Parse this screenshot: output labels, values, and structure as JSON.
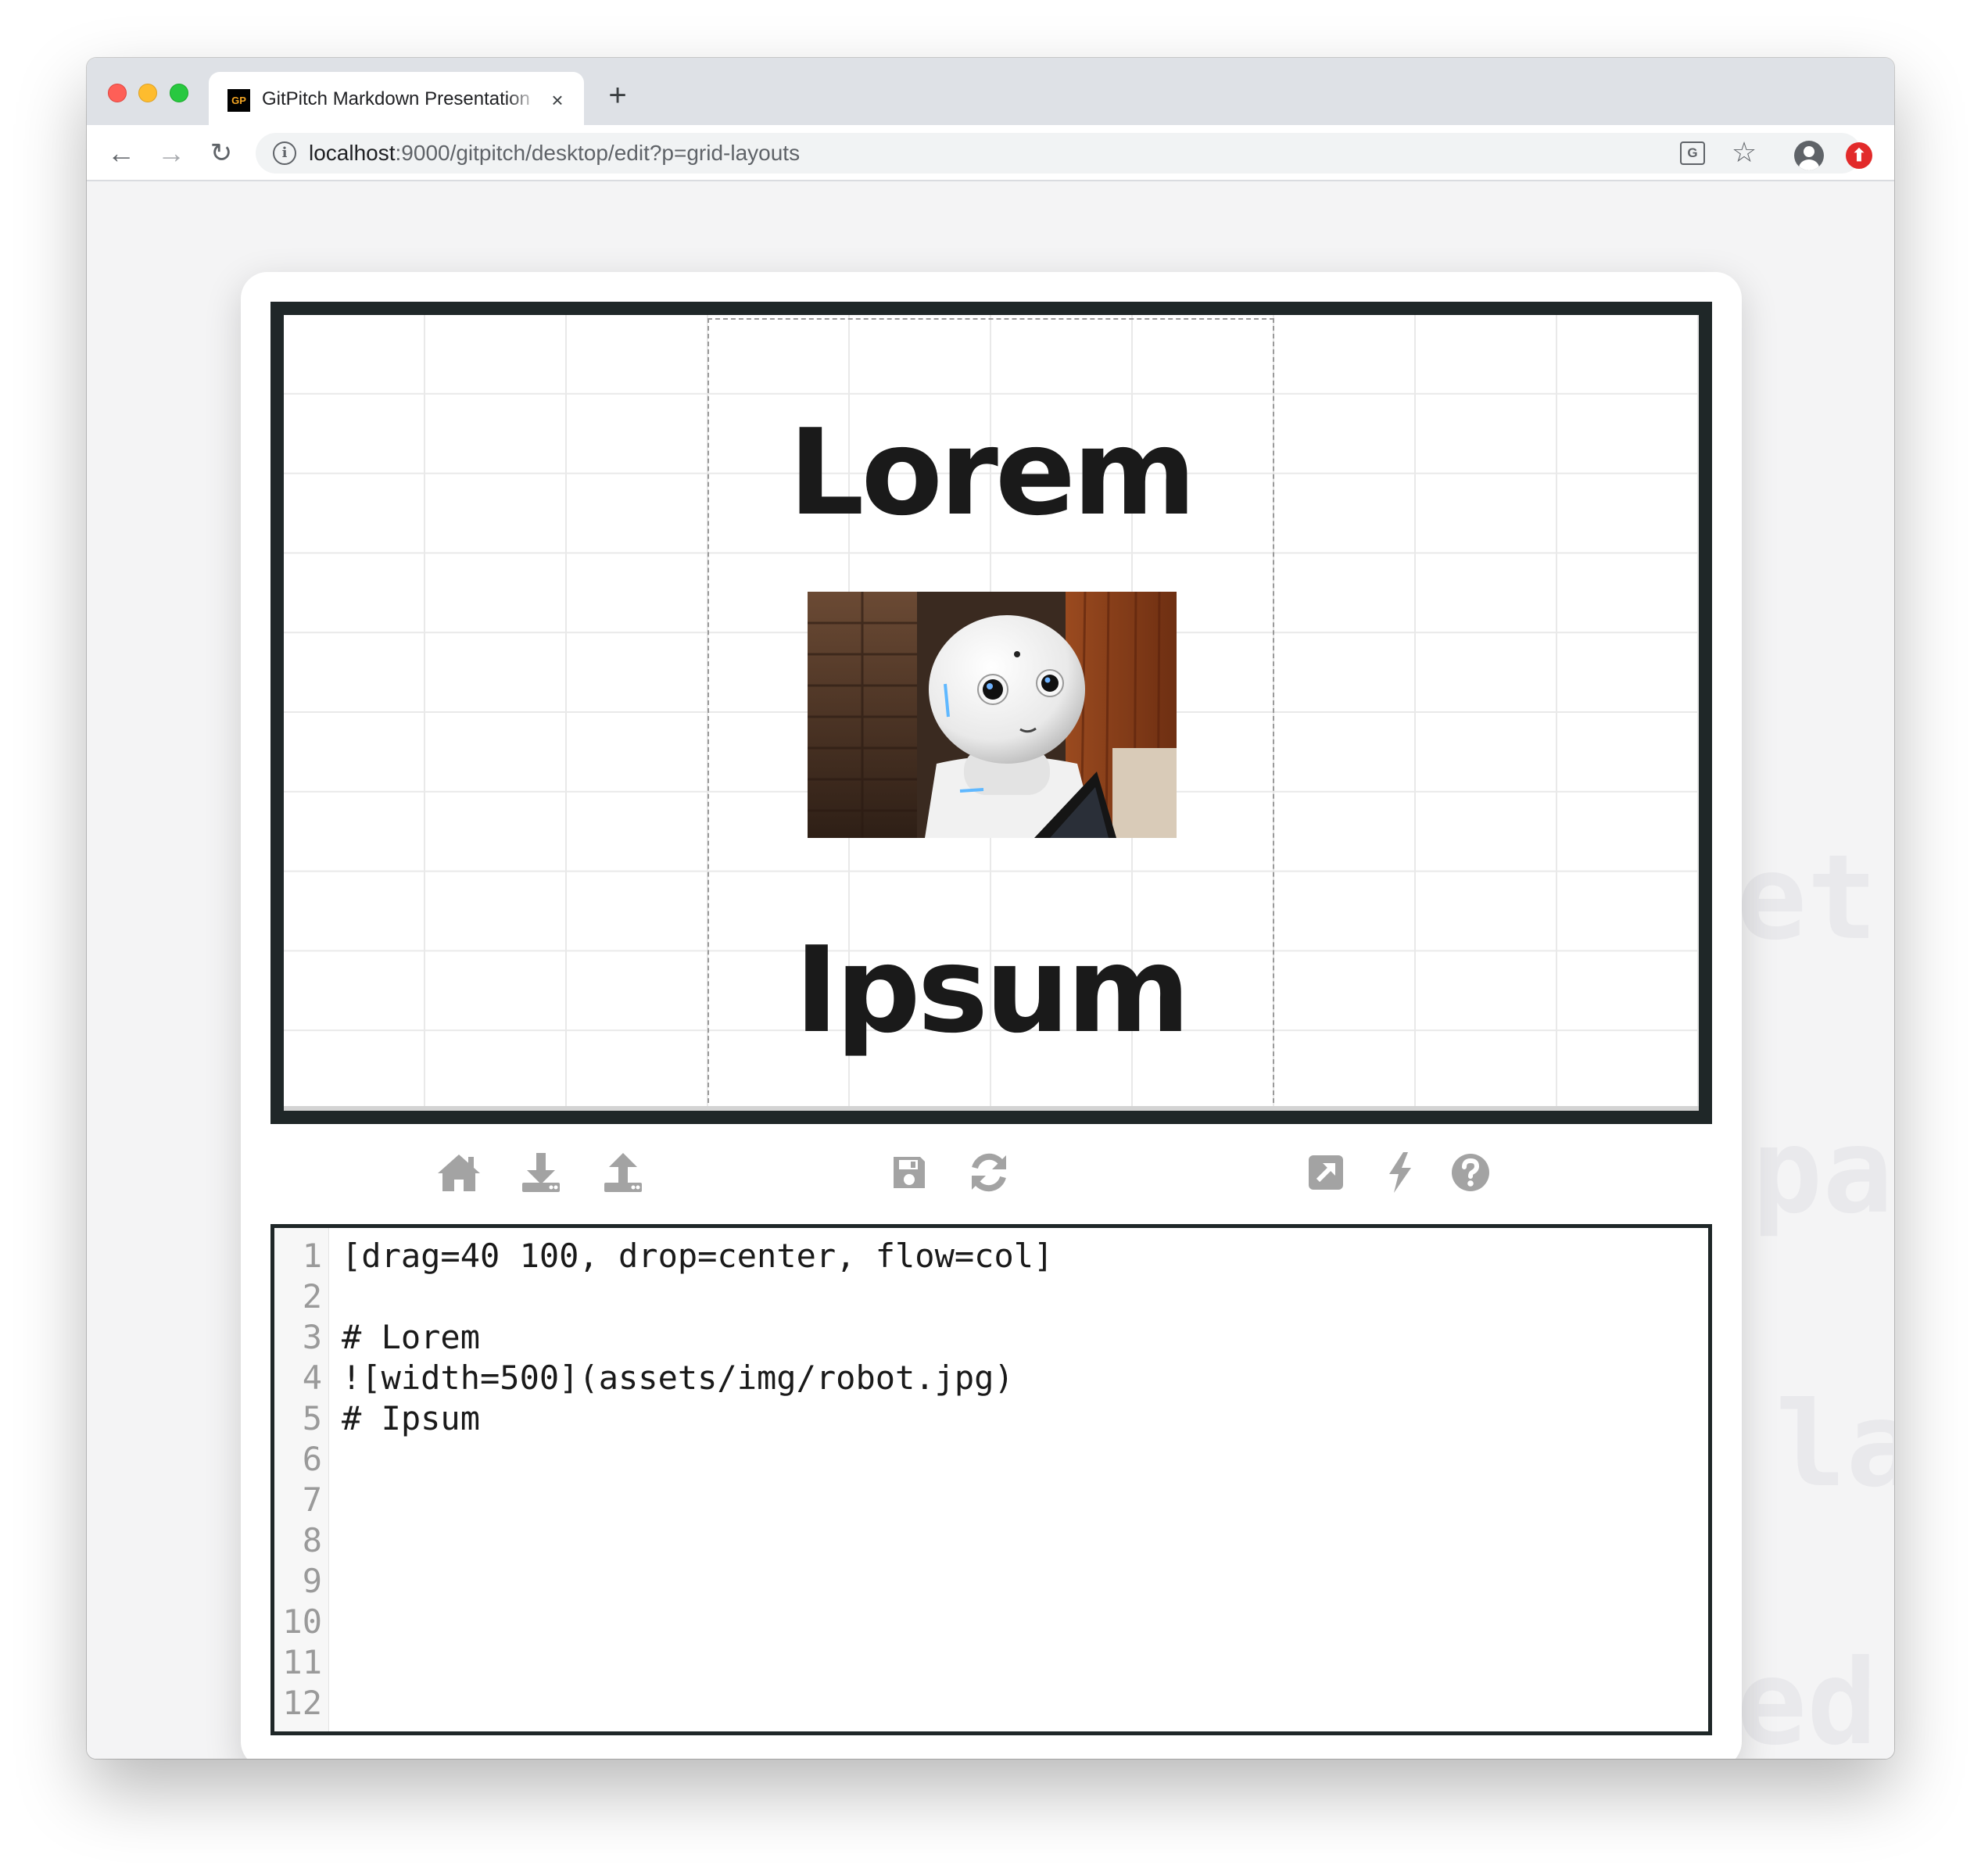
{
  "browser": {
    "tab": {
      "favicon_text": "GP",
      "title": "GitPitch Markdown Presentation",
      "close_glyph": "×"
    },
    "new_tab_glyph": "+",
    "nav": {
      "back_glyph": "←",
      "forward_glyph": "→",
      "reload_glyph": "↻"
    },
    "url": {
      "host": "localhost",
      "path": ":9000/gitpitch/desktop/edit?p=grid-layouts"
    },
    "info_glyph": "i",
    "translate_glyph": "G",
    "star_glyph": "☆",
    "extension_glyph": "⬆"
  },
  "slide": {
    "heading_top": "Lorem",
    "heading_bottom": "Ipsum",
    "image_subject": "robot"
  },
  "toolbar_icons": [
    "home-icon",
    "download-icon",
    "upload-icon",
    "save-icon",
    "refresh-icon",
    "external-link-icon",
    "lightning-icon",
    "help-icon"
  ],
  "editor": {
    "line_numbers": [
      "1",
      "2",
      "3",
      "4",
      "5",
      "6",
      "7",
      "8",
      "9",
      "10",
      "11",
      "12"
    ],
    "lines": [
      "[drag=40 100, drop=center, flow=col]",
      "",
      "# Lorem",
      "![width=500](assets/img/robot.jpg)",
      "# Ipsum",
      "",
      "",
      "",
      "",
      "",
      "",
      ""
    ]
  },
  "colors": {
    "frame": "#1f2728",
    "icon_gray": "#a3a3a3",
    "heading": "#1a1a1a"
  }
}
